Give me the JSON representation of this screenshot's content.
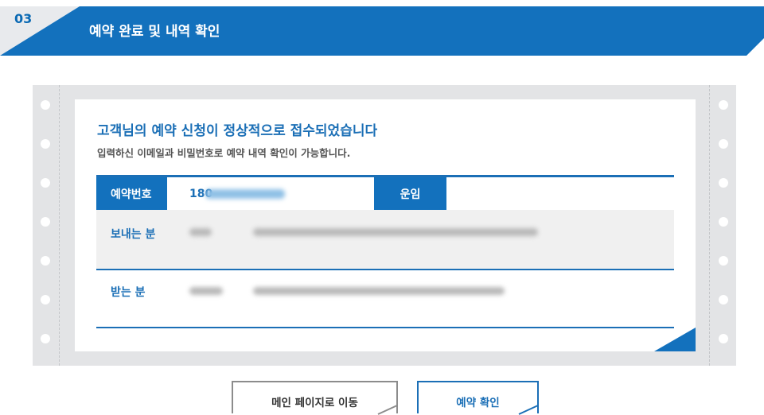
{
  "header": {
    "step_number": "03",
    "title": "예약 완료 및 내역 확인"
  },
  "message": {
    "headline": "고객님의 예약 신청이 정상적으로 접수되었습니다",
    "subline": "입력하신 이메일과 비밀번호로 예약 내역 확인이 가능합니다."
  },
  "table": {
    "reservation_label": "예약번호",
    "reservation_value": "180",
    "fare_label": "운임",
    "fare_value": "",
    "sender_label": "보내는 분",
    "receiver_label": "받는 분"
  },
  "buttons": {
    "main_page": "메인 페이지로 이동",
    "confirm": "예약 확인"
  },
  "colors": {
    "brand_blue": "#1371bd",
    "frame_gray": "#e3e4e6",
    "row_gray": "#f0f0f0"
  }
}
